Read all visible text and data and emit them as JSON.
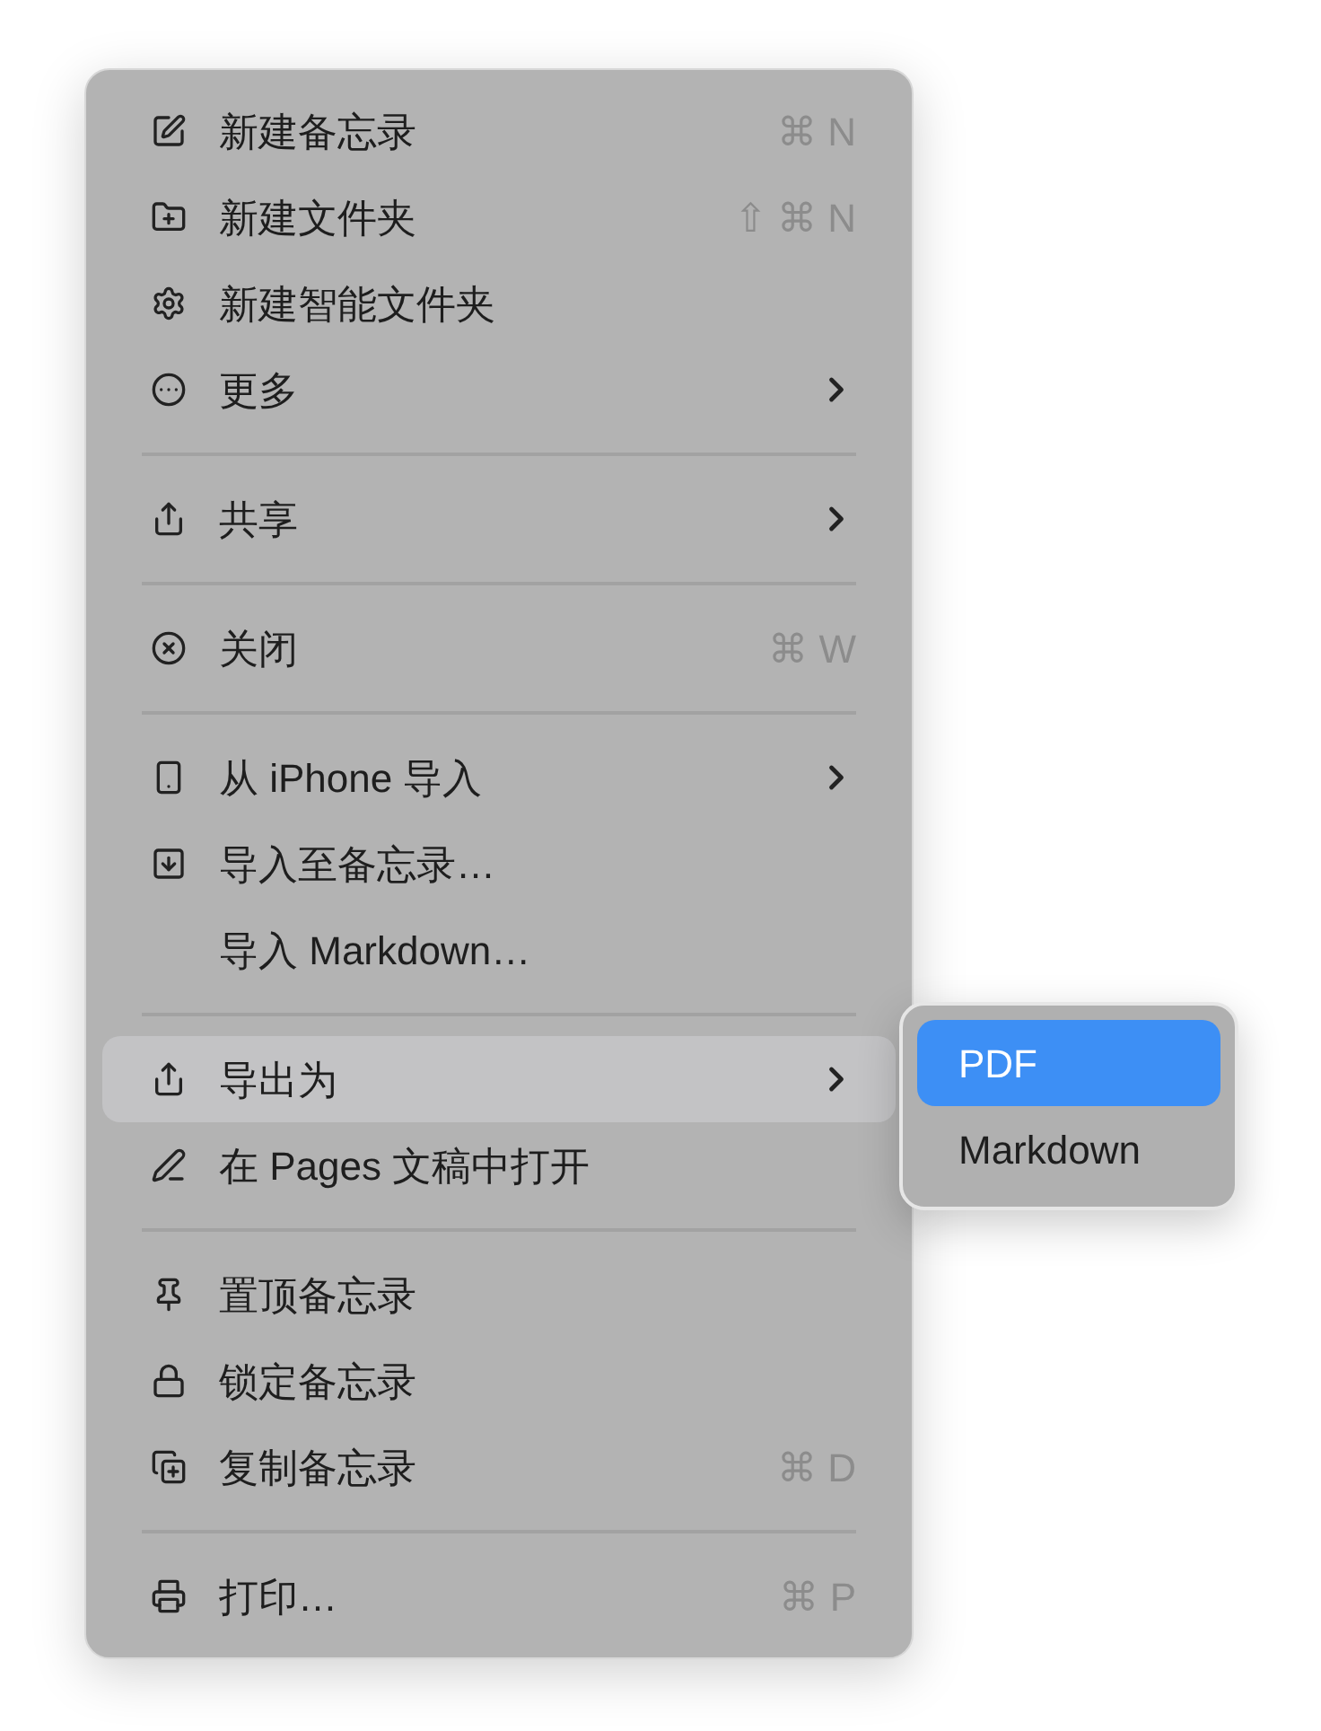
{
  "menu": {
    "groups": [
      {
        "items": [
          {
            "label": "新建备忘录",
            "shortcut": "⌘ N",
            "submenu": false,
            "selected": false
          },
          {
            "label": "新建文件夹",
            "shortcut": "⇧ ⌘ N",
            "submenu": false,
            "selected": false
          },
          {
            "label": "新建智能文件夹",
            "submenu": false,
            "selected": false
          },
          {
            "label": "更多",
            "submenu": true,
            "selected": false
          }
        ]
      },
      {
        "items": [
          {
            "label": "共享",
            "submenu": true,
            "selected": false
          }
        ]
      },
      {
        "items": [
          {
            "label": "关闭",
            "shortcut": "⌘ W",
            "submenu": false,
            "selected": false
          }
        ]
      },
      {
        "items": [
          {
            "label": "从 iPhone 导入",
            "submenu": true,
            "selected": false
          },
          {
            "label": "导入至备忘录…",
            "submenu": false,
            "selected": false
          },
          {
            "label": "导入 Markdown…",
            "submenu": false,
            "selected": false
          }
        ]
      },
      {
        "items": [
          {
            "label": "导出为",
            "submenu": true,
            "selected": true
          },
          {
            "label": "在 Pages 文稿中打开",
            "submenu": false,
            "selected": false
          }
        ]
      },
      {
        "items": [
          {
            "label": "置顶备忘录",
            "submenu": false,
            "selected": false
          },
          {
            "label": "锁定备忘录",
            "submenu": false,
            "selected": false
          },
          {
            "label": "复制备忘录",
            "shortcut": "⌘ D",
            "submenu": false,
            "selected": false
          }
        ]
      },
      {
        "items": [
          {
            "label": "打印…",
            "shortcut": "⌘ P",
            "submenu": false,
            "selected": false
          }
        ]
      }
    ]
  },
  "submenu": {
    "items": [
      {
        "label": "PDF",
        "selected": true
      },
      {
        "label": "Markdown",
        "selected": false
      }
    ]
  }
}
